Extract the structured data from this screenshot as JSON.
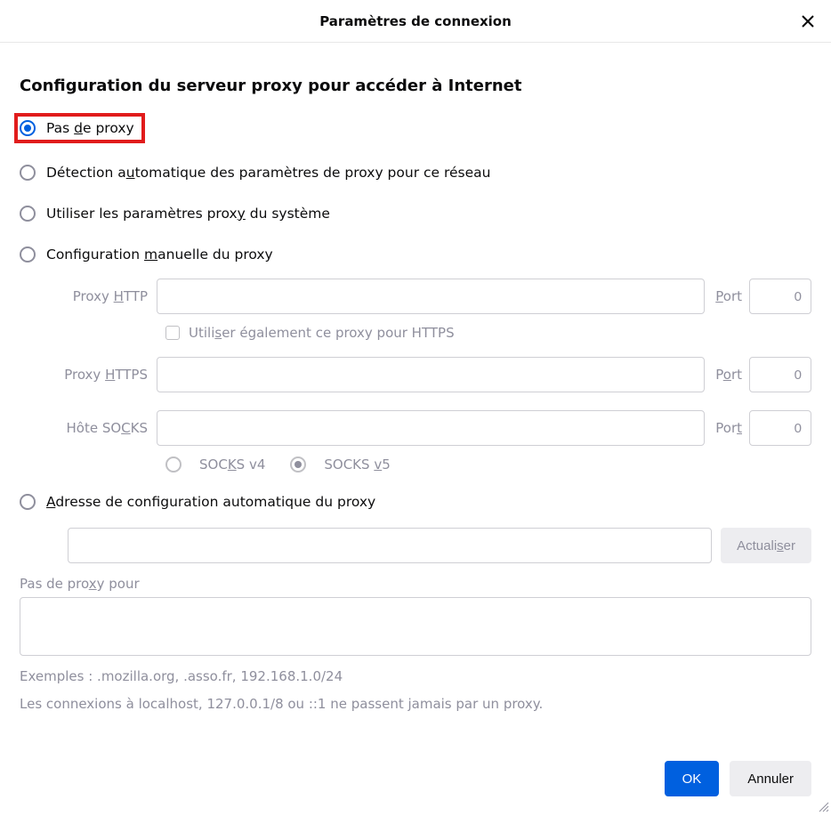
{
  "dialog": {
    "title": "Paramètres de connexion",
    "heading": "Configuration du serveur proxy pour accéder à Internet"
  },
  "proxy_modes": {
    "none": {
      "label_pre": "Pas ",
      "label_u": "d",
      "label_post": "e proxy",
      "checked": true
    },
    "auto_detect": {
      "label_pre": "Détection a",
      "label_u": "u",
      "label_post": "tomatique des paramètres de proxy pour ce réseau",
      "checked": false
    },
    "system": {
      "label_pre": "Utiliser les paramètres prox",
      "label_u": "y",
      "label_post": " du système",
      "checked": false
    },
    "manual": {
      "label_pre": "Configuration ",
      "label_u": "m",
      "label_post": "anuelle du proxy",
      "checked": false
    },
    "pac": {
      "label_pre": "",
      "label_u": "A",
      "label_post": "dresse de configuration automatique du proxy",
      "checked": false
    }
  },
  "manual": {
    "http": {
      "label_pre": "Proxy ",
      "label_u": "H",
      "label_post": "TTP",
      "host": "",
      "port_label_pre": "",
      "port_label_u": "P",
      "port_label_post": "ort",
      "port": "0"
    },
    "share": {
      "label_pre": "Utili",
      "label_u": "s",
      "label_post": "er également ce proxy pour HTTPS",
      "checked": false
    },
    "https": {
      "label_pre": "Proxy ",
      "label_u": "H",
      "label_post": "TTPS",
      "host": "",
      "port_label_pre": "P",
      "port_label_u": "o",
      "port_label_post": "rt",
      "port": "0"
    },
    "socks": {
      "label_pre": "Hôte SO",
      "label_u": "C",
      "label_post": "KS",
      "host": "",
      "port_label_pre": "Por",
      "port_label_u": "t",
      "port_label_post": "",
      "port": "0"
    },
    "socks_v4": {
      "label_pre": "SOC",
      "label_u": "K",
      "label_post": "S v4",
      "checked": false
    },
    "socks_v5": {
      "label_pre": "SOCKS ",
      "label_u": "v",
      "label_post": "5",
      "checked": true
    }
  },
  "pac": {
    "url": "",
    "reload_label_pre": "Actuali",
    "reload_label_u": "s",
    "reload_label_post": "er"
  },
  "no_proxy": {
    "label_pre": "Pas de pro",
    "label_u": "x",
    "label_post": "y pour",
    "value": "",
    "example": "Exemples : .mozilla.org, .asso.fr, 192.168.1.0/24",
    "localhost_note": "Les connexions à localhost, 127.0.0.1/8 ou ::1 ne passent jamais par un proxy."
  },
  "buttons": {
    "ok": "OK",
    "cancel": "Annuler"
  }
}
